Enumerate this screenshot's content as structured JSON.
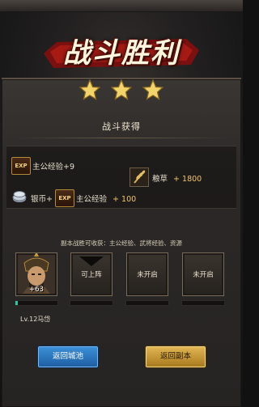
{
  "top_bar": {
    "left_text": "",
    "right_text": ""
  },
  "banner": {
    "title": "战斗胜利"
  },
  "stars": {
    "count": 3
  },
  "rewards": {
    "section_title": "战斗获得",
    "lord_exp": "主公经验+9",
    "grain_label": "粮草",
    "grain_value": "+ 1800",
    "silver_label": "银币+",
    "lord_exp2_label": "主公经验",
    "lord_exp2_value": "+ 100",
    "exp_icon_text": "EXP"
  },
  "hint": "副本战胜可收获：主公经验、武将经验、资源",
  "slots": [
    {
      "type": "hero",
      "plus": "+63"
    },
    {
      "type": "available",
      "label": "可上阵"
    },
    {
      "type": "locked",
      "label": "未开启"
    },
    {
      "type": "locked",
      "label": "未开启"
    }
  ],
  "hero": {
    "level_name": "Lv.12马岱",
    "exp_progress": 0.06
  },
  "buttons": {
    "return_city": "返回城池",
    "return_dungeon": "返回副本"
  },
  "colors": {
    "accent_gold": "#f0c46a",
    "exp_bar": "#2ec4a6",
    "btn_blue": "#2f7fcb",
    "btn_gold": "#d3a23b"
  }
}
